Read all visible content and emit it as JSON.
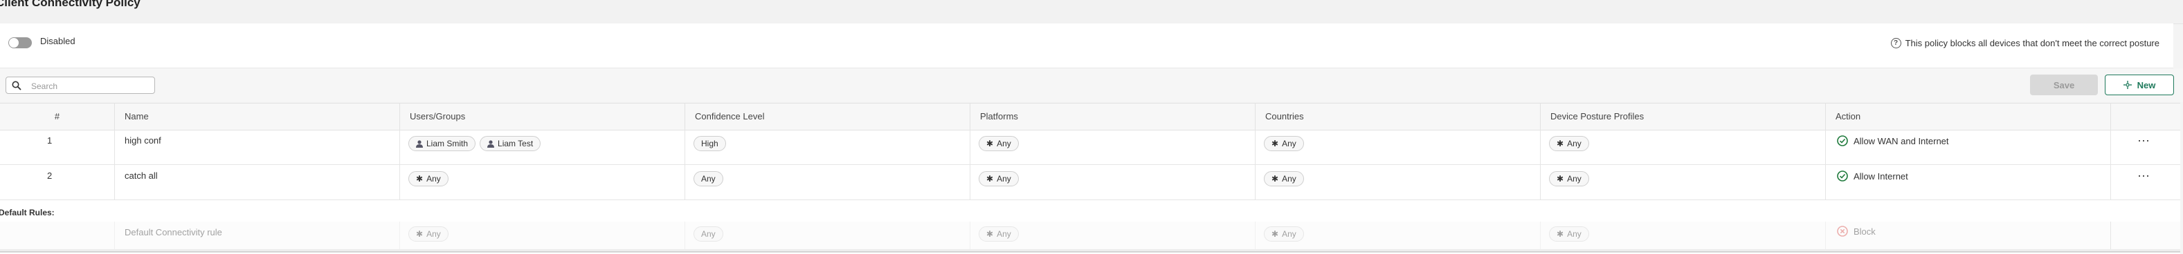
{
  "header": {
    "title": "Client Connectivity Policy"
  },
  "toggle": {
    "label": "Disabled"
  },
  "policy_note": "This policy blocks all devices that don't meet the correct posture",
  "search": {
    "placeholder": "Search",
    "value": ""
  },
  "buttons": {
    "save": "Save",
    "new": "New"
  },
  "table": {
    "columns": [
      "#",
      "Name",
      "Users/Groups",
      "Confidence Level",
      "Platforms",
      "Countries",
      "Device Posture Profiles",
      "Action"
    ],
    "rows": [
      {
        "index": "1",
        "name": "high conf",
        "users": [
          "Liam Smith",
          "Liam Test"
        ],
        "confidence": "High",
        "platforms": "Any",
        "countries": "Any",
        "profiles": "Any",
        "action": "Allow WAN and Internet"
      },
      {
        "index": "2",
        "name": "catch all",
        "users_any": "Any",
        "confidence": "Any",
        "platforms": "Any",
        "countries": "Any",
        "profiles": "Any",
        "action": "Allow Internet"
      }
    ],
    "default_rules_label": "Default Rules:",
    "default_rule": {
      "name": "Default Connectivity rule",
      "users": "Any",
      "confidence": "Any",
      "platforms": "Any",
      "countries": "Any",
      "profiles": "Any",
      "action": "Block"
    }
  },
  "colors": {
    "allow": "#1f7a3c",
    "block": "#d9534f",
    "accent": "#1f7a5c"
  }
}
